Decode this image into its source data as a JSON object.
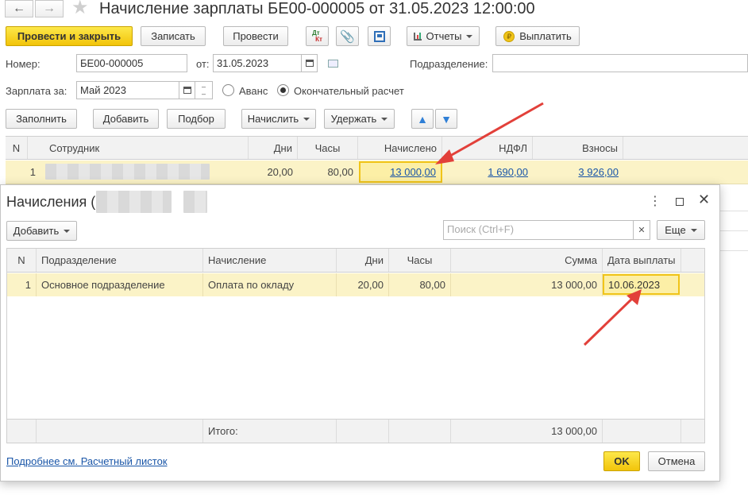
{
  "window": {
    "title": "Начисление зарплаты БЕ00-000005 от 31.05.2023 12:00:00"
  },
  "toolbar": {
    "post_close": "Провести и закрыть",
    "save": "Записать",
    "post": "Провести",
    "reports": "Отчеты",
    "pay": "Выплатить",
    "dtkt_top": "Дт",
    "dtkt_bottom": "Кт"
  },
  "form": {
    "number_label": "Номер:",
    "number_value": "БЕ00-000005",
    "date_label": "от:",
    "date_value": "31.05.2023",
    "division_label": "Подразделение:",
    "division_value": "",
    "salary_label": "Зарплата за:",
    "salary_value": "Май 2023",
    "radio_advance": "Аванс",
    "radio_final": "Окончательный расчет"
  },
  "actions": {
    "fill": "Заполнить",
    "add": "Добавить",
    "select": "Подбор",
    "accrue": "Начислить",
    "withhold": "Удержать"
  },
  "main_table": {
    "headers": [
      "N",
      "Сотрудник",
      "Дни",
      "Часы",
      "Начислено",
      "НДФЛ",
      "Взносы"
    ],
    "rows": [
      {
        "n": "1",
        "employee": "",
        "days": "20,00",
        "hours": "80,00",
        "accrued": "13 000,00",
        "ndfl": "1 690,00",
        "contrib": "3 926,00"
      }
    ]
  },
  "dialog": {
    "title": "Начисления (",
    "add": "Добавить",
    "search_placeholder": "Поиск (Ctrl+F)",
    "more": "Еще",
    "headers": [
      "N",
      "Подразделение",
      "Начисление",
      "Дни",
      "Часы",
      "Сумма",
      "Дата выплаты"
    ],
    "rows": [
      {
        "n": "1",
        "division": "Основное подразделение",
        "accrual": "Оплата по окладу",
        "days": "20,00",
        "hours": "80,00",
        "sum": "13 000,00",
        "pay_date": "10.06.2023"
      }
    ],
    "footer_label": "Итого:",
    "footer_sum": "13 000,00",
    "details_link": "Подробнее см. Расчетный листок",
    "ok": "OK",
    "cancel": "Отмена"
  },
  "colors": {
    "accent_yellow": "#f5cb1a",
    "row_highlight": "#fbf3c7",
    "link_blue": "#1a56a8",
    "arrow_red": "#e2403a"
  }
}
